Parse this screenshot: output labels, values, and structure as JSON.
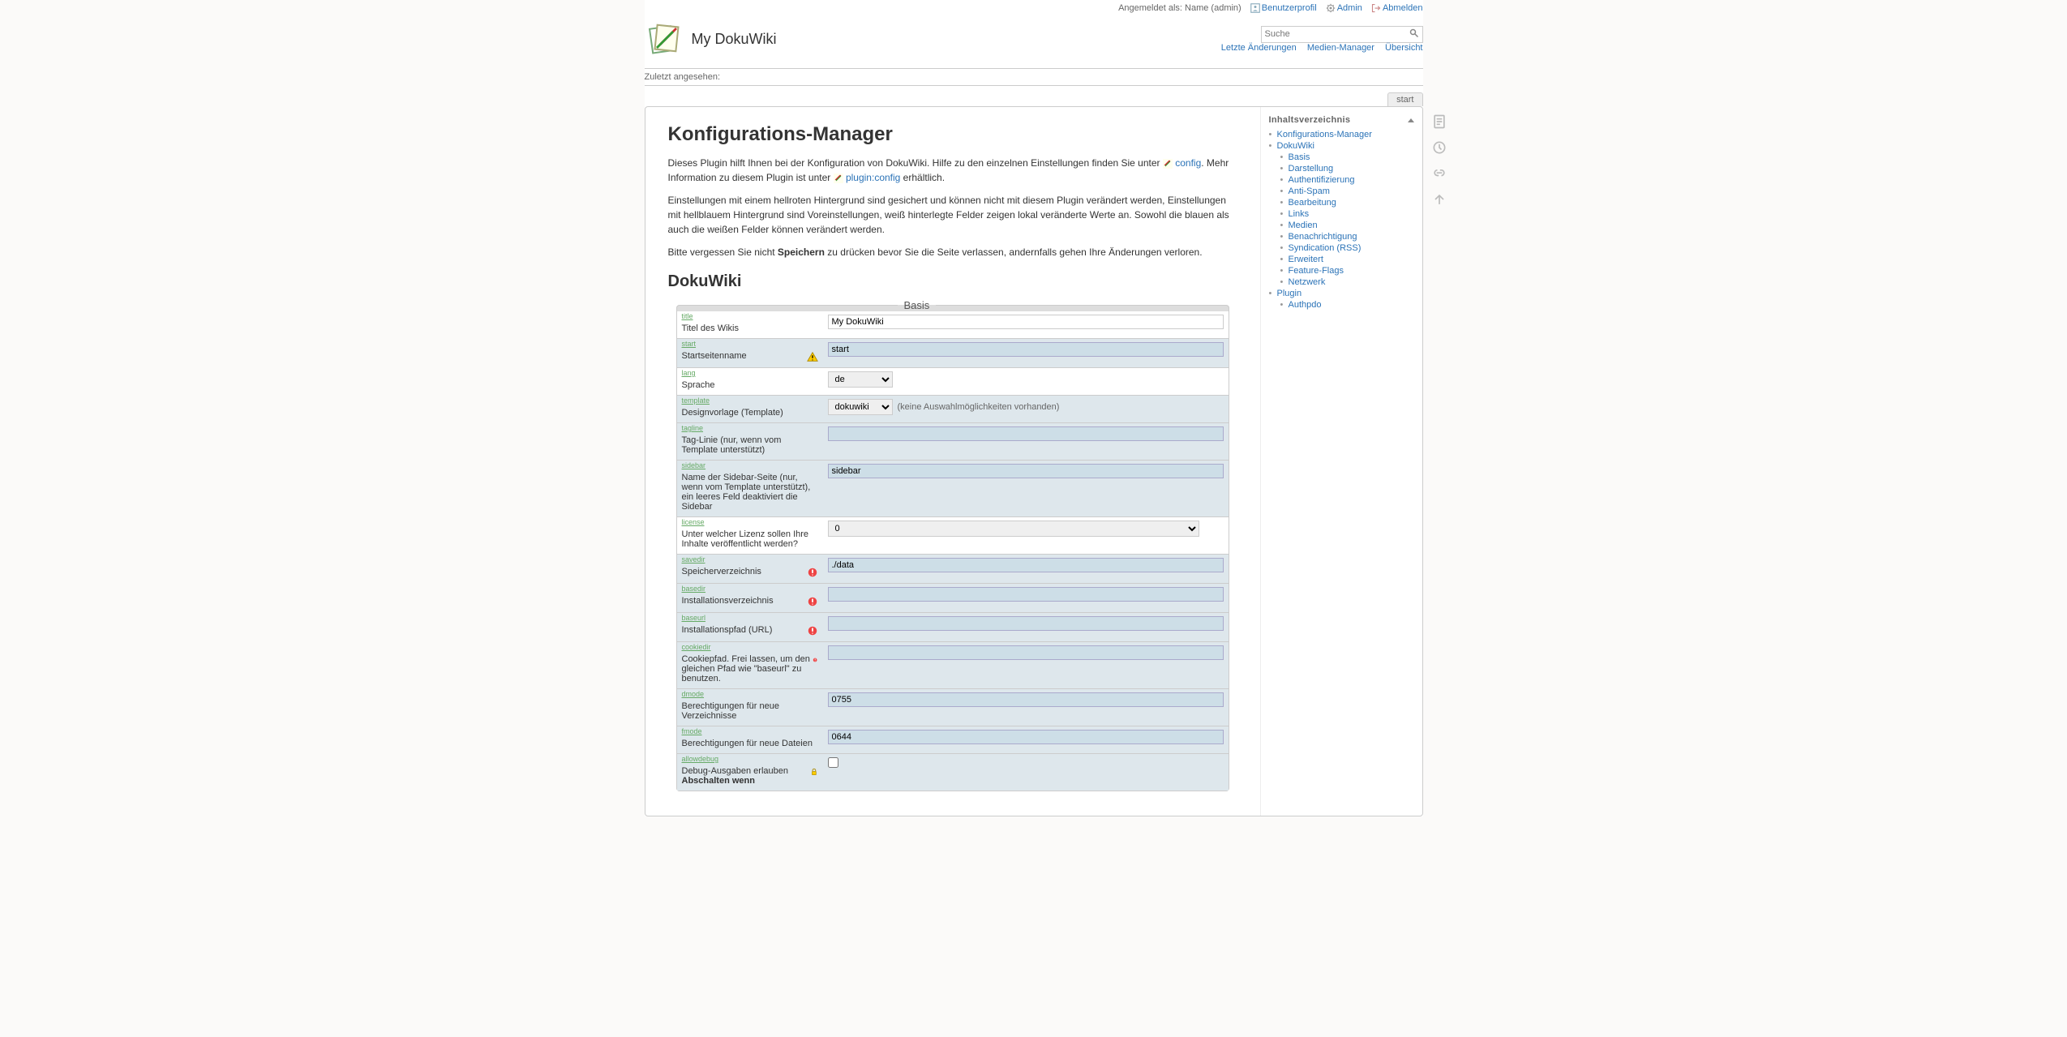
{
  "usertools": {
    "logged_in_prefix": "Angemeldet als: ",
    "username": "Name (admin)",
    "profile": "Benutzerprofil",
    "admin": "Admin",
    "logout": "Abmelden"
  },
  "site": {
    "name": "My DokuWiki"
  },
  "search": {
    "placeholder": "Suche"
  },
  "header_links": {
    "recent": "Letzte Änderungen",
    "media": "Medien-Manager",
    "sitemap": "Übersicht"
  },
  "trace": {
    "label": "Zuletzt angesehen:"
  },
  "tab": {
    "start": "start"
  },
  "page": {
    "h1": "Konfigurations-Manager",
    "intro1a": "Dieses Plugin hilft Ihnen bei der Konfiguration von DokuWiki. Hilfe zu den einzelnen Einstellungen finden Sie unter ",
    "link_config": "config",
    "intro1b": ". Mehr Information zu diesem Plugin ist unter ",
    "link_plugin": "plugin:config",
    "intro1c": " erhältlich.",
    "intro2": "Einstellungen mit einem hellroten Hintergrund sind gesichert und können nicht mit diesem Plugin verändert werden, Einstellungen mit hellblauem Hintergrund sind Voreinstellungen, weiß hinterlegte Felder zeigen lokal veränderte Werte an. Sowohl die blauen als auch die weißen Felder können verändert werden.",
    "intro3a": "Bitte vergessen Sie nicht ",
    "intro3b": "Speichern",
    "intro3c": " zu drücken bevor Sie die Seite verlassen, andernfalls gehen Ihre Änderungen verloren.",
    "h2": "DokuWiki"
  },
  "toc": {
    "title": "Inhaltsverzeichnis",
    "items": {
      "i0": "Konfigurations-Manager",
      "i1": "DokuWiki",
      "sub": {
        "s0": "Basis",
        "s1": "Darstellung",
        "s2": "Authentifizierung",
        "s3": "Anti-Spam",
        "s4": "Bearbeitung",
        "s5": "Links",
        "s6": "Medien",
        "s7": "Benachrichtigung",
        "s8": "Syndication (RSS)",
        "s9": "Erweitert",
        "s10": "Feature-Flags",
        "s11": "Netzwerk"
      },
      "i2": "Plugin",
      "sub2": {
        "p0": "Authpdo"
      }
    }
  },
  "config": {
    "legend": "Basis",
    "rows": {
      "title": {
        "key": "title",
        "label": "Titel des Wikis",
        "value": "My DokuWiki"
      },
      "start": {
        "key": "start",
        "label": "Startseitenname",
        "value": "start"
      },
      "lang": {
        "key": "lang",
        "label": "Sprache",
        "value": "de"
      },
      "template": {
        "key": "template",
        "label": "Designvorlage (Template)",
        "value": "dokuwiki",
        "note": "(keine Auswahlmöglichkeiten vorhanden)"
      },
      "tagline": {
        "key": "tagline",
        "label": "Tag-Linie (nur, wenn vom Template unterstützt)",
        "value": ""
      },
      "sidebar": {
        "key": "sidebar",
        "label": "Name der Sidebar-Seite (nur, wenn vom Template unterstützt), ein leeres Feld deaktiviert die Sidebar",
        "value": "sidebar"
      },
      "license": {
        "key": "license",
        "label": "Unter welcher Lizenz sollen Ihre Inhalte veröffentlicht werden?",
        "value": "0"
      },
      "savedir": {
        "key": "savedir",
        "label": "Speicherverzeichnis",
        "value": "./data"
      },
      "basedir": {
        "key": "basedir",
        "label": "Installationsverzeichnis",
        "value": ""
      },
      "baseurl": {
        "key": "baseurl",
        "label": "Installationspfad (URL)",
        "value": ""
      },
      "cookiedir": {
        "key": "cookiedir",
        "label": "Cookiepfad. Frei lassen, um den gleichen Pfad wie \"baseurl\" zu benutzen.",
        "value": ""
      },
      "dmode": {
        "key": "dmode",
        "label": "Berechtigungen für neue Verzeichnisse",
        "value": "0755"
      },
      "fmode": {
        "key": "fmode",
        "label": "Berechtigungen für neue Dateien",
        "value": "0644"
      },
      "allowdebug": {
        "key": "allowdebug",
        "label_a": "Debug-Ausgaben erlauben ",
        "label_b": "Abschalten wenn"
      }
    }
  }
}
